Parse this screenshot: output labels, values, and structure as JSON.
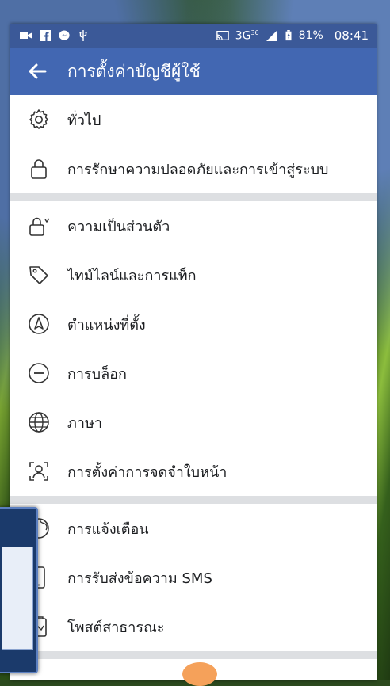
{
  "status_bar": {
    "signal_text": "3G",
    "signal_sup": "36",
    "battery": "81%",
    "time": "08:41"
  },
  "header": {
    "title": "การตั้งค่าบัญชีผู้ใช้"
  },
  "sections": [
    {
      "items": [
        {
          "label": "ทั่วไป",
          "icon": "gear-icon"
        },
        {
          "label": "การรักษาความปลอดภัยและการเข้าสู่ระบบ",
          "icon": "lock-icon"
        }
      ]
    },
    {
      "items": [
        {
          "label": "ความเป็นส่วนตัว",
          "icon": "privacy-lock-icon"
        },
        {
          "label": "ไทม์ไลน์และการแท็ก",
          "icon": "tag-icon"
        },
        {
          "label": "ตำแหน่งที่ตั้ง",
          "icon": "location-icon"
        },
        {
          "label": "การบล็อก",
          "icon": "block-icon"
        },
        {
          "label": "ภาษา",
          "icon": "globe-icon"
        },
        {
          "label": "การตั้งค่าการจดจำใบหน้า",
          "icon": "face-recognition-icon"
        }
      ]
    },
    {
      "items": [
        {
          "label": "การแจ้งเตือน",
          "icon": "notification-globe-icon"
        },
        {
          "label": "การรับส่งข้อความ SMS",
          "icon": "phone-icon"
        },
        {
          "label": "โพสต์สาธารณะ",
          "icon": "public-post-icon"
        }
      ]
    }
  ],
  "colors": {
    "status_bar": "#3b5998",
    "header": "#4267b2",
    "divider": "#dddfe2",
    "text": "#1c1e21"
  }
}
